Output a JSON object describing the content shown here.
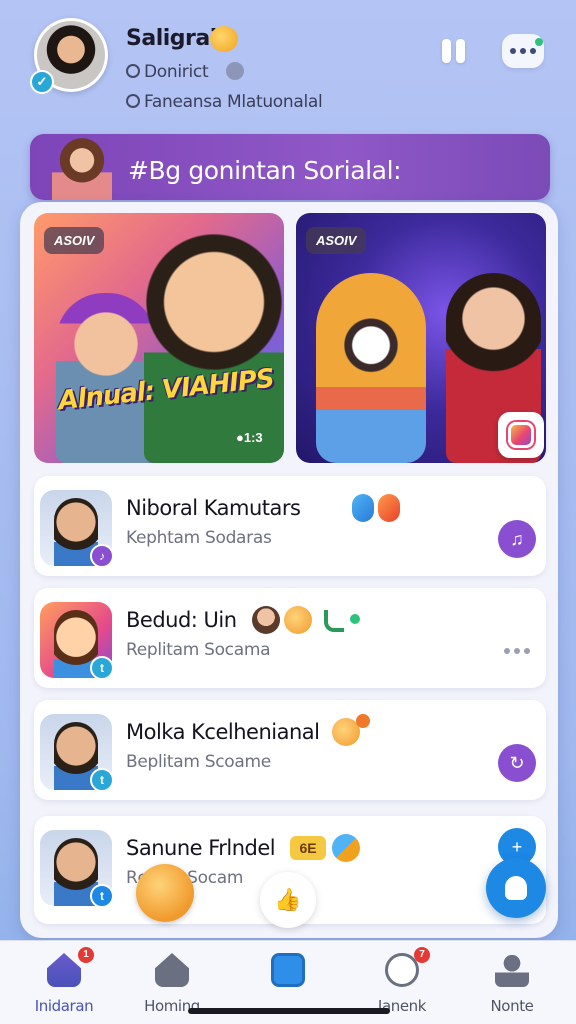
{
  "profile": {
    "name": "Saligrai",
    "meta1": "Donirict",
    "meta2": "Faneansa Mlatuonalal"
  },
  "banner": {
    "title": "#Bg gonintan Sorialal:"
  },
  "tiles": [
    {
      "badge": "ASOIV",
      "wordmark": "Alnual: VIAHIPS",
      "counter": "●1:3"
    },
    {
      "badge": "ASOIV"
    }
  ],
  "list": [
    {
      "title": "Niboral Kamutars",
      "subtitle": "Kephtam Sodaras",
      "accent": "#8a4fd0"
    },
    {
      "title": "Bedud: Uin",
      "subtitle": "Replitam Socama",
      "accent": "#29a8d8"
    },
    {
      "title": "Molka Kcelhenianal",
      "subtitle": "Beplitam Scoame",
      "accent": "#8a4fd0"
    },
    {
      "title": "Sanune Frlndel",
      "subtitle": "Rcolun Socam",
      "chip": "6E",
      "accent": "#1e88e5"
    }
  ],
  "bottom_nav": [
    {
      "label": "Inidaran",
      "badge": "1"
    },
    {
      "label": "Homing"
    },
    {
      "label": ""
    },
    {
      "label": "Janenk",
      "badge": "7"
    },
    {
      "label": "Nonte"
    }
  ],
  "colors": {
    "accent_purple": "#7d45b8",
    "fab_blue": "#1e88e5",
    "nav_active": "#4a52b8"
  }
}
